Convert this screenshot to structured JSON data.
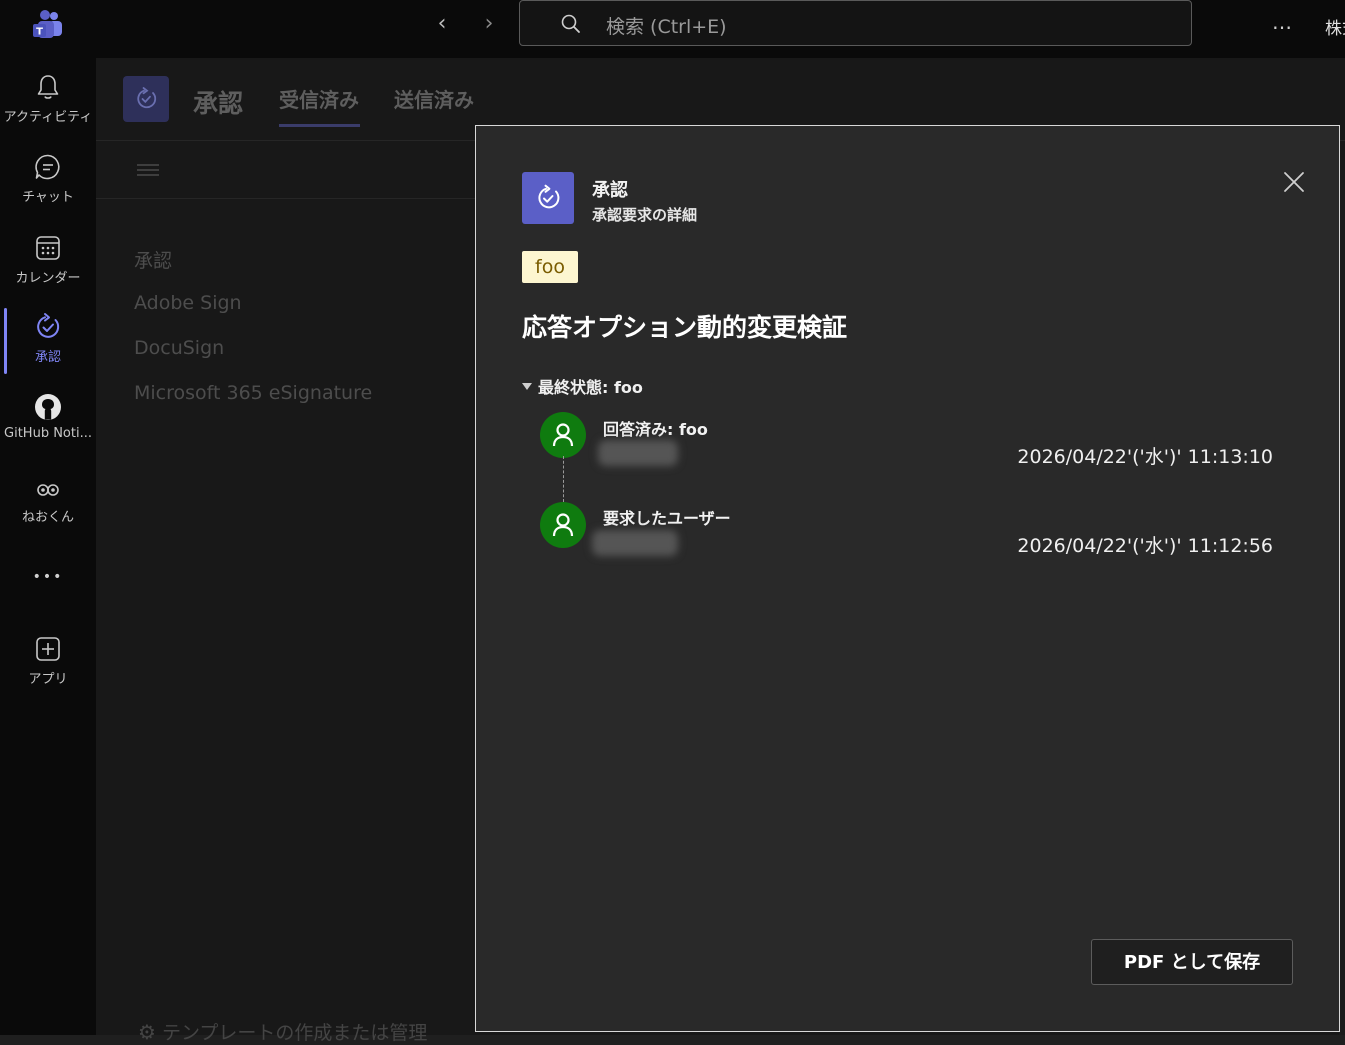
{
  "titlebar": {
    "search_placeholder": "検索 (Ctrl+E)",
    "back_glyph": "‹",
    "forward_glyph": "›",
    "more_glyph": "…",
    "user_label": "株式"
  },
  "rail": {
    "items": [
      {
        "label": "アクティビティ",
        "icon": "bell-icon"
      },
      {
        "label": "チャット",
        "icon": "chat-icon"
      },
      {
        "label": "カレンダー",
        "icon": "calendar-icon"
      },
      {
        "label": "承認",
        "icon": "approvals-icon",
        "active": true
      },
      {
        "label": "GitHub Noti...",
        "icon": "github-icon"
      },
      {
        "label": "ねおくん",
        "icon": "glasses-icon"
      },
      {
        "label": "",
        "icon": "more-icon"
      },
      {
        "label": "アプリ",
        "icon": "add-app-icon"
      }
    ],
    "more_glyph": "•••"
  },
  "app": {
    "title": "承認",
    "tabs": [
      "受信済み",
      "送信済み"
    ],
    "active_tab": 0,
    "list": [
      "承認",
      "Adobe Sign",
      "DocuSign",
      "Microsoft 365 eSignature"
    ],
    "footer_link": "テンプレートの作成または管理"
  },
  "dialog": {
    "title": "承認",
    "subtitle": "承認要求の詳細",
    "tag": "foo",
    "request_title": "応答オプション動的変更検証",
    "final_status": "最終状態: foo",
    "events": [
      {
        "label": "回答済み: foo",
        "time": "2026/04/22'('水')' 11:13:10"
      },
      {
        "label": "要求したユーザー",
        "time": "2026/04/22'('水')' 11:12:56"
      }
    ],
    "pdf_button": "PDF として保存"
  },
  "colors": {
    "accent": "#5b5fc7",
    "rail_active": "#7f85f5",
    "avatar_green": "#0f7b0f",
    "tag_bg": "#fdf6d0"
  }
}
